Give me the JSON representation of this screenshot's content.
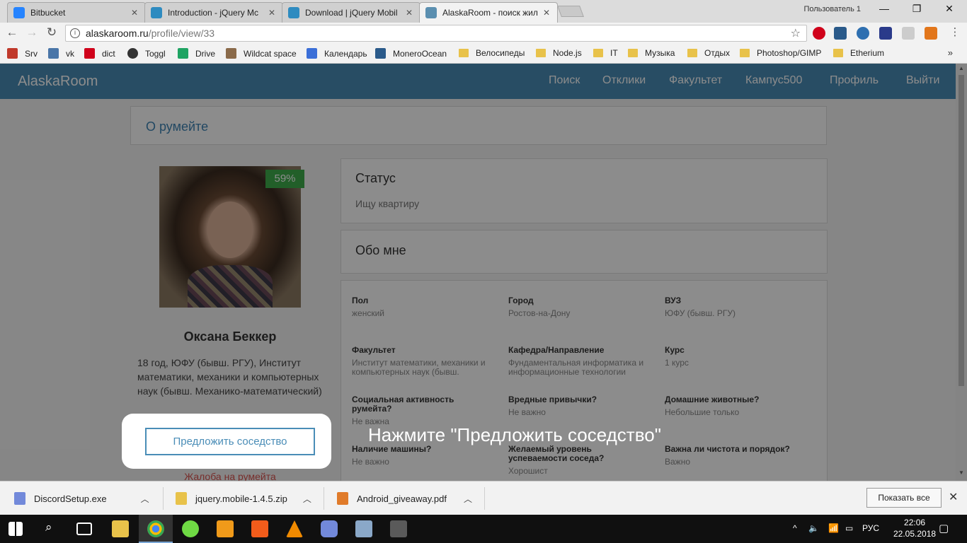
{
  "browser": {
    "tabs": [
      {
        "label": "Bitbucket",
        "color": "#2684ff"
      },
      {
        "label": "Introduction - jQuery Mc",
        "color": "#2e8bc0"
      },
      {
        "label": "Download | jQuery Mobil",
        "color": "#2e8bc0"
      },
      {
        "label": "AlaskaRoom - поиск жил",
        "color": "#5b8fb0"
      }
    ],
    "user": "Пользователь 1",
    "url_host": "alaskaroom.ru",
    "url_path": "/profile/view/33",
    "bookmarks": [
      {
        "label": "Srv",
        "icon": "srv-icon",
        "color": "#c0392b"
      },
      {
        "label": "vk",
        "icon": "vk-icon",
        "color": "#4a76a8"
      },
      {
        "label": "dict",
        "icon": "dict-icon",
        "color": "#d0021b"
      },
      {
        "label": "Toggl",
        "icon": "toggl-icon",
        "color": "#333333"
      },
      {
        "label": "Drive",
        "icon": "drive-icon",
        "color": "#1fa463"
      },
      {
        "label": "Wildcat space",
        "icon": "wildcat-icon",
        "color": "#8a6a4a"
      },
      {
        "label": "Календарь",
        "icon": "calendar-icon",
        "color": "#3b6fd8"
      },
      {
        "label": "MoneroOcean",
        "icon": "monero-icon",
        "color": "#2a5a8a"
      },
      {
        "label": "Велосипеды",
        "icon": "folder-icon",
        "color": "#e8c24a"
      },
      {
        "label": "Node.js",
        "icon": "folder-icon",
        "color": "#e8c24a"
      },
      {
        "label": "IT",
        "icon": "folder-icon",
        "color": "#e8c24a"
      },
      {
        "label": "Музыка",
        "icon": "folder-icon",
        "color": "#e8c24a"
      },
      {
        "label": "Отдых",
        "icon": "folder-icon",
        "color": "#e8c24a"
      },
      {
        "label": "Photoshop/GIMP",
        "icon": "folder-icon",
        "color": "#e8c24a"
      },
      {
        "label": "Etherium",
        "icon": "folder-icon",
        "color": "#e8c24a"
      }
    ],
    "more": "»"
  },
  "site": {
    "brand": "AlaskaRoom",
    "nav": [
      "Поиск",
      "Отклики",
      "Факультет",
      "Кампус500",
      "Профиль",
      "Выйти"
    ],
    "about_title": "О румейте",
    "accent": "#4a8db7"
  },
  "profile": {
    "match": "59%",
    "name": "Оксана Беккер",
    "description": "18 год, ЮФУ (бывш. РГУ), Институт математики, механики и компьютерных наук (бывш. Механико-математический)",
    "offer_button": "Предложить соседство",
    "complaint_link": "Жалоба на румейта"
  },
  "status_card": {
    "title": "Статус",
    "text": "Ищу квартиру"
  },
  "about_me_card": {
    "title": "Обо мне"
  },
  "details": [
    {
      "label": "Пол",
      "value": "женский"
    },
    {
      "label": "Город",
      "value": "Ростов-на-Дону"
    },
    {
      "label": "ВУЗ",
      "value": "ЮФУ (бывш. РГУ)"
    },
    {
      "label": "Факультет",
      "value": "Институт математики, механики и компьютерных наук (бывш."
    },
    {
      "label": "Кафедра/Направление",
      "value": "Фундаментальная информатика и информационные технологии"
    },
    {
      "label": "Курс",
      "value": "1 курс"
    },
    {
      "label": "Социальная активность румейта?",
      "value": "Не важна"
    },
    {
      "label": "Вредные привычки?",
      "value": "Не важно"
    },
    {
      "label": "Домашние животные?",
      "value": "Небольшие только"
    },
    {
      "label": "Наличие машины?",
      "value": "Не важно"
    },
    {
      "label": "Желаемый уровень успеваемости соседа?",
      "value": "Хорошист"
    },
    {
      "label": "Важна ли чистота и порядок?",
      "value": "Важно"
    }
  ],
  "hint": "Нажмите \"Предложить соседство\"",
  "downloads": {
    "items": [
      {
        "name": "DiscordSetup.exe",
        "color": "#7289da"
      },
      {
        "name": "jquery.mobile-1.4.5.zip",
        "color": "#e8c24a"
      },
      {
        "name": "Android_giveaway.pdf",
        "color": "#e07b2a"
      }
    ],
    "show_all": "Показать все"
  },
  "taskbar": {
    "lang": "РУС",
    "time": "22:06",
    "date": "22.05.2018"
  }
}
